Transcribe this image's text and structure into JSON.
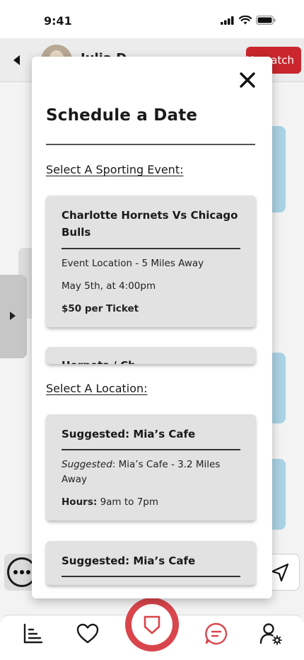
{
  "status": {
    "time": "9:41"
  },
  "chat": {
    "name": "Julia D",
    "unmatch_label": "Unmatch"
  },
  "modal": {
    "title": "Schedule a Date",
    "sporting_label": "Select A Sporting Event:",
    "events": [
      {
        "title": "Charlotte Hornets Vs Chicago Bulls",
        "location": "Event Location - 5 Miles Away",
        "date": "May 5th, at 4:00pm",
        "price": "$50 per Ticket"
      },
      {
        "title": "Hornets / Ch"
      }
    ],
    "location_label": "Select A Location:",
    "locations": [
      {
        "title": "Suggested: Mia’s Cafe",
        "suggested_prefix": "Suggested",
        "suggested_text": ": Mia’s Cafe - 3.2 Miles Away",
        "hours_label": "Hours:",
        "hours_value": " 9am to 7pm"
      },
      {
        "title": "Suggested: Mia’s Cafe"
      }
    ]
  },
  "icons": {
    "back": "back-arrow-icon",
    "close": "close-icon",
    "more": "more-dots-icon",
    "send": "send-icon",
    "nav": [
      "leaderboard-icon",
      "heart-icon",
      "shield-icon",
      "chat-icon",
      "profile-settings-icon"
    ]
  },
  "colors": {
    "accent": "#d9454c",
    "unmatch": "#c9272d",
    "bubble": "#a9d2e4",
    "card": "#e2e2e2"
  }
}
